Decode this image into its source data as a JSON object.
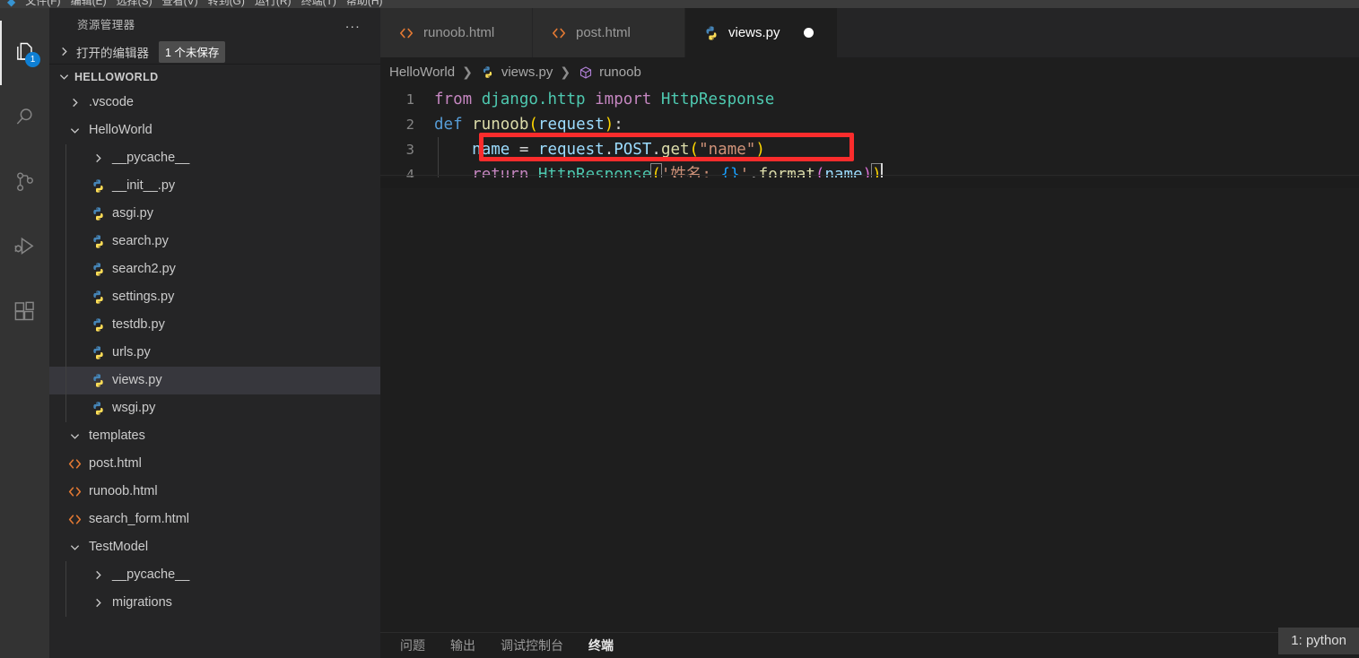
{
  "window": {
    "menubar_items": [
      "文件(F)",
      "编辑(E)",
      "选择(S)",
      "查看(V)",
      "转到(G)",
      "运行(R)",
      "终端(T)",
      "帮助(H)"
    ]
  },
  "activitybar": {
    "items": [
      {
        "name": "explorer",
        "icon": "files-icon",
        "active": true,
        "badge": "1"
      },
      {
        "name": "search",
        "icon": "search-icon",
        "active": false,
        "badge": ""
      },
      {
        "name": "source-control",
        "icon": "source-control-icon",
        "active": false,
        "badge": ""
      },
      {
        "name": "run-debug",
        "icon": "run-and-debug-icon",
        "active": false,
        "badge": ""
      },
      {
        "name": "extensions",
        "icon": "extensions-icon",
        "active": false,
        "badge": ""
      }
    ]
  },
  "sidebar": {
    "title": "资源管理器",
    "more_actions": "...",
    "open_editors": {
      "label": "打开的编辑器",
      "badge": "1 个未保存"
    },
    "root": {
      "label": "HELLOWORLD"
    },
    "tree": [
      {
        "label": ".vscode",
        "icon": "chevron-right-icon",
        "depth": 1,
        "type": "folder",
        "selected": false
      },
      {
        "label": "HelloWorld",
        "icon": "chevron-down-icon",
        "depth": 1,
        "type": "folder",
        "selected": false
      },
      {
        "label": "__pycache__",
        "icon": "chevron-right-icon",
        "depth": 2,
        "type": "folder",
        "selected": false
      },
      {
        "label": "__init__.py",
        "icon": "python-icon",
        "depth": 2,
        "type": "file",
        "selected": false
      },
      {
        "label": "asgi.py",
        "icon": "python-icon",
        "depth": 2,
        "type": "file",
        "selected": false
      },
      {
        "label": "search.py",
        "icon": "python-icon",
        "depth": 2,
        "type": "file",
        "selected": false
      },
      {
        "label": "search2.py",
        "icon": "python-icon",
        "depth": 2,
        "type": "file",
        "selected": false
      },
      {
        "label": "settings.py",
        "icon": "python-icon",
        "depth": 2,
        "type": "file",
        "selected": false
      },
      {
        "label": "testdb.py",
        "icon": "python-icon",
        "depth": 2,
        "type": "file",
        "selected": false
      },
      {
        "label": "urls.py",
        "icon": "python-icon",
        "depth": 2,
        "type": "file",
        "selected": false
      },
      {
        "label": "views.py",
        "icon": "python-icon",
        "depth": 2,
        "type": "file",
        "selected": true
      },
      {
        "label": "wsgi.py",
        "icon": "python-icon",
        "depth": 2,
        "type": "file",
        "selected": false
      },
      {
        "label": "templates",
        "icon": "chevron-down-icon",
        "depth": 1,
        "type": "folder",
        "selected": false
      },
      {
        "label": "post.html",
        "icon": "html-icon",
        "depth": 1,
        "type": "file",
        "selected": false
      },
      {
        "label": "runoob.html",
        "icon": "html-icon",
        "depth": 1,
        "type": "file",
        "selected": false
      },
      {
        "label": "search_form.html",
        "icon": "html-icon",
        "depth": 1,
        "type": "file",
        "selected": false
      },
      {
        "label": "TestModel",
        "icon": "chevron-down-icon",
        "depth": 1,
        "type": "folder",
        "selected": false
      },
      {
        "label": "__pycache__",
        "icon": "chevron-right-icon",
        "depth": 2,
        "type": "folder",
        "selected": false
      },
      {
        "label": "migrations",
        "icon": "chevron-right-icon",
        "depth": 2,
        "type": "folder",
        "selected": false
      }
    ]
  },
  "editor": {
    "tabs": [
      {
        "label": "runoob.html",
        "icon": "html-icon",
        "active": false,
        "dirty": false
      },
      {
        "label": "post.html",
        "icon": "html-icon",
        "active": false,
        "dirty": false
      },
      {
        "label": "views.py",
        "icon": "python-icon",
        "active": true,
        "dirty": true
      }
    ],
    "breadcrumbs": [
      {
        "label": "HelloWorld",
        "icon": ""
      },
      {
        "label": "views.py",
        "icon": "python-icon"
      },
      {
        "label": "runoob",
        "icon": "symbol-method-icon"
      }
    ],
    "line_numbers": [
      "1",
      "2",
      "3",
      "4"
    ],
    "code": {
      "l1_kw_from": "from",
      "l1_module": " django.http ",
      "l1_kw_import": "import",
      "l1_class": " HttpResponse",
      "l2_kw_def": "def",
      "l2_fn": " runoob",
      "l2_paren_open": "(",
      "l2_arg": "request",
      "l2_paren_close": ")",
      "l2_colon": ":",
      "l3_var": "name",
      "l3_eq": " = ",
      "l3_obj": "request",
      "l3_dot1": ".",
      "l3_attr": "POST",
      "l3_dot2": ".",
      "l3_method": "get",
      "l3_paren_open": "(",
      "l3_string": "\"name\"",
      "l3_paren_close": ")",
      "l4_kw_return": "return",
      "l4_class": " HttpResponse",
      "l4_paren_open": "(",
      "l4_str_a": "'姓名: ",
      "l4_brace": "{}",
      "l4_str_b": "'",
      "l4_dot": ".",
      "l4_method": "format",
      "l4_paren2_open": "(",
      "l4_arg": "name",
      "l4_paren2_close": ")",
      "l4_paren_close": ")"
    },
    "annotation": {
      "name": "red-highlight-box",
      "color": "#fb2c2c"
    }
  },
  "panel": {
    "tabs": [
      {
        "label": "问题",
        "active": false
      },
      {
        "label": "输出",
        "active": false
      },
      {
        "label": "调试控制台",
        "active": false
      },
      {
        "label": "终端",
        "active": true
      }
    ],
    "terminal_selector": "1: python"
  },
  "colors": {
    "editor_bg": "#1e1e1e",
    "sidebar_bg": "#252526",
    "activitybar_bg": "#333333",
    "tab_inactive_bg": "#2d2d2d",
    "selection_bg": "#37373d",
    "badge_blue": "#0e7fd4",
    "annotation_red": "#fb2c2c"
  }
}
